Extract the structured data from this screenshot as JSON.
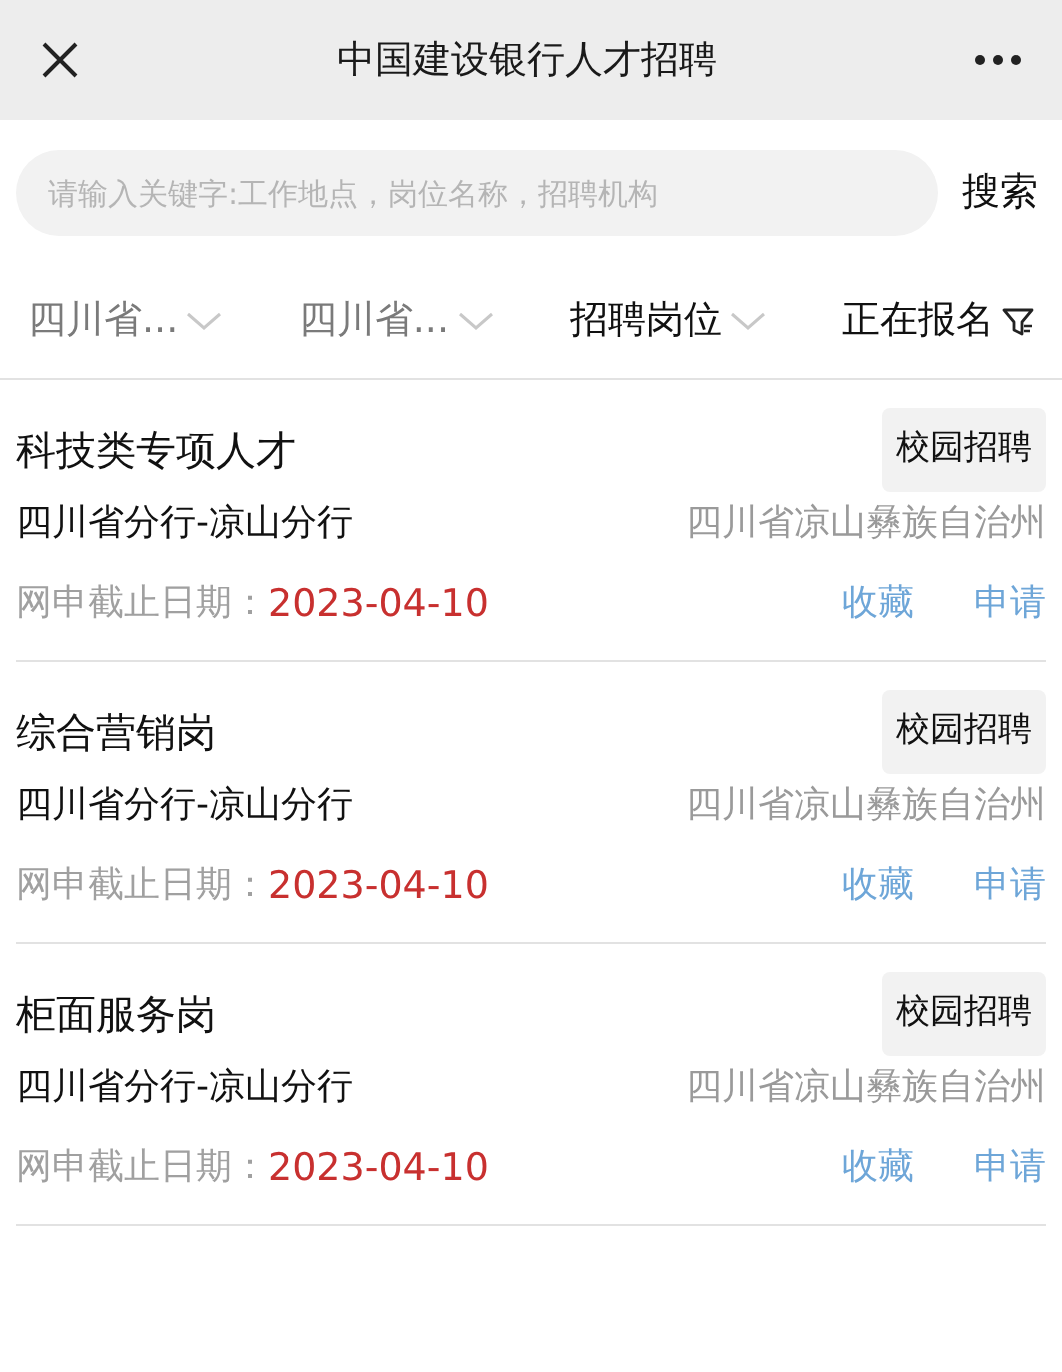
{
  "window": {
    "title": "中国建设银行人才招聘"
  },
  "search": {
    "placeholder": "请输入关键字:工作地点，岗位名称，招聘机构",
    "button": "搜索"
  },
  "filters": [
    {
      "label": "四川省...",
      "kind": "dropdown",
      "dimmed": true
    },
    {
      "label": "四川省...",
      "kind": "dropdown",
      "dimmed": true
    },
    {
      "label": "招聘岗位",
      "kind": "dropdown",
      "dimmed": false
    },
    {
      "label": "正在报名",
      "kind": "filter",
      "dimmed": false
    }
  ],
  "jobs": [
    {
      "title": "科技类专项人才",
      "tag": "校园招聘",
      "org": "四川省分行-凉山分行",
      "location": "四川省凉山彝族自治州",
      "deadline_label": "网申截止日期：",
      "deadline": "2023-04-10",
      "actions": [
        "收藏",
        "申请"
      ]
    },
    {
      "title": "综合营销岗",
      "tag": "校园招聘",
      "org": "四川省分行-凉山分行",
      "location": "四川省凉山彝族自治州",
      "deadline_label": "网申截止日期：",
      "deadline": "2023-04-10",
      "actions": [
        "收藏",
        "申请"
      ]
    },
    {
      "title": "柜面服务岗",
      "tag": "校园招聘",
      "org": "四川省分行-凉山分行",
      "location": "四川省凉山彝族自治州",
      "deadline_label": "网申截止日期：",
      "deadline": "2023-04-10",
      "actions": [
        "收藏",
        "申请"
      ]
    }
  ]
}
